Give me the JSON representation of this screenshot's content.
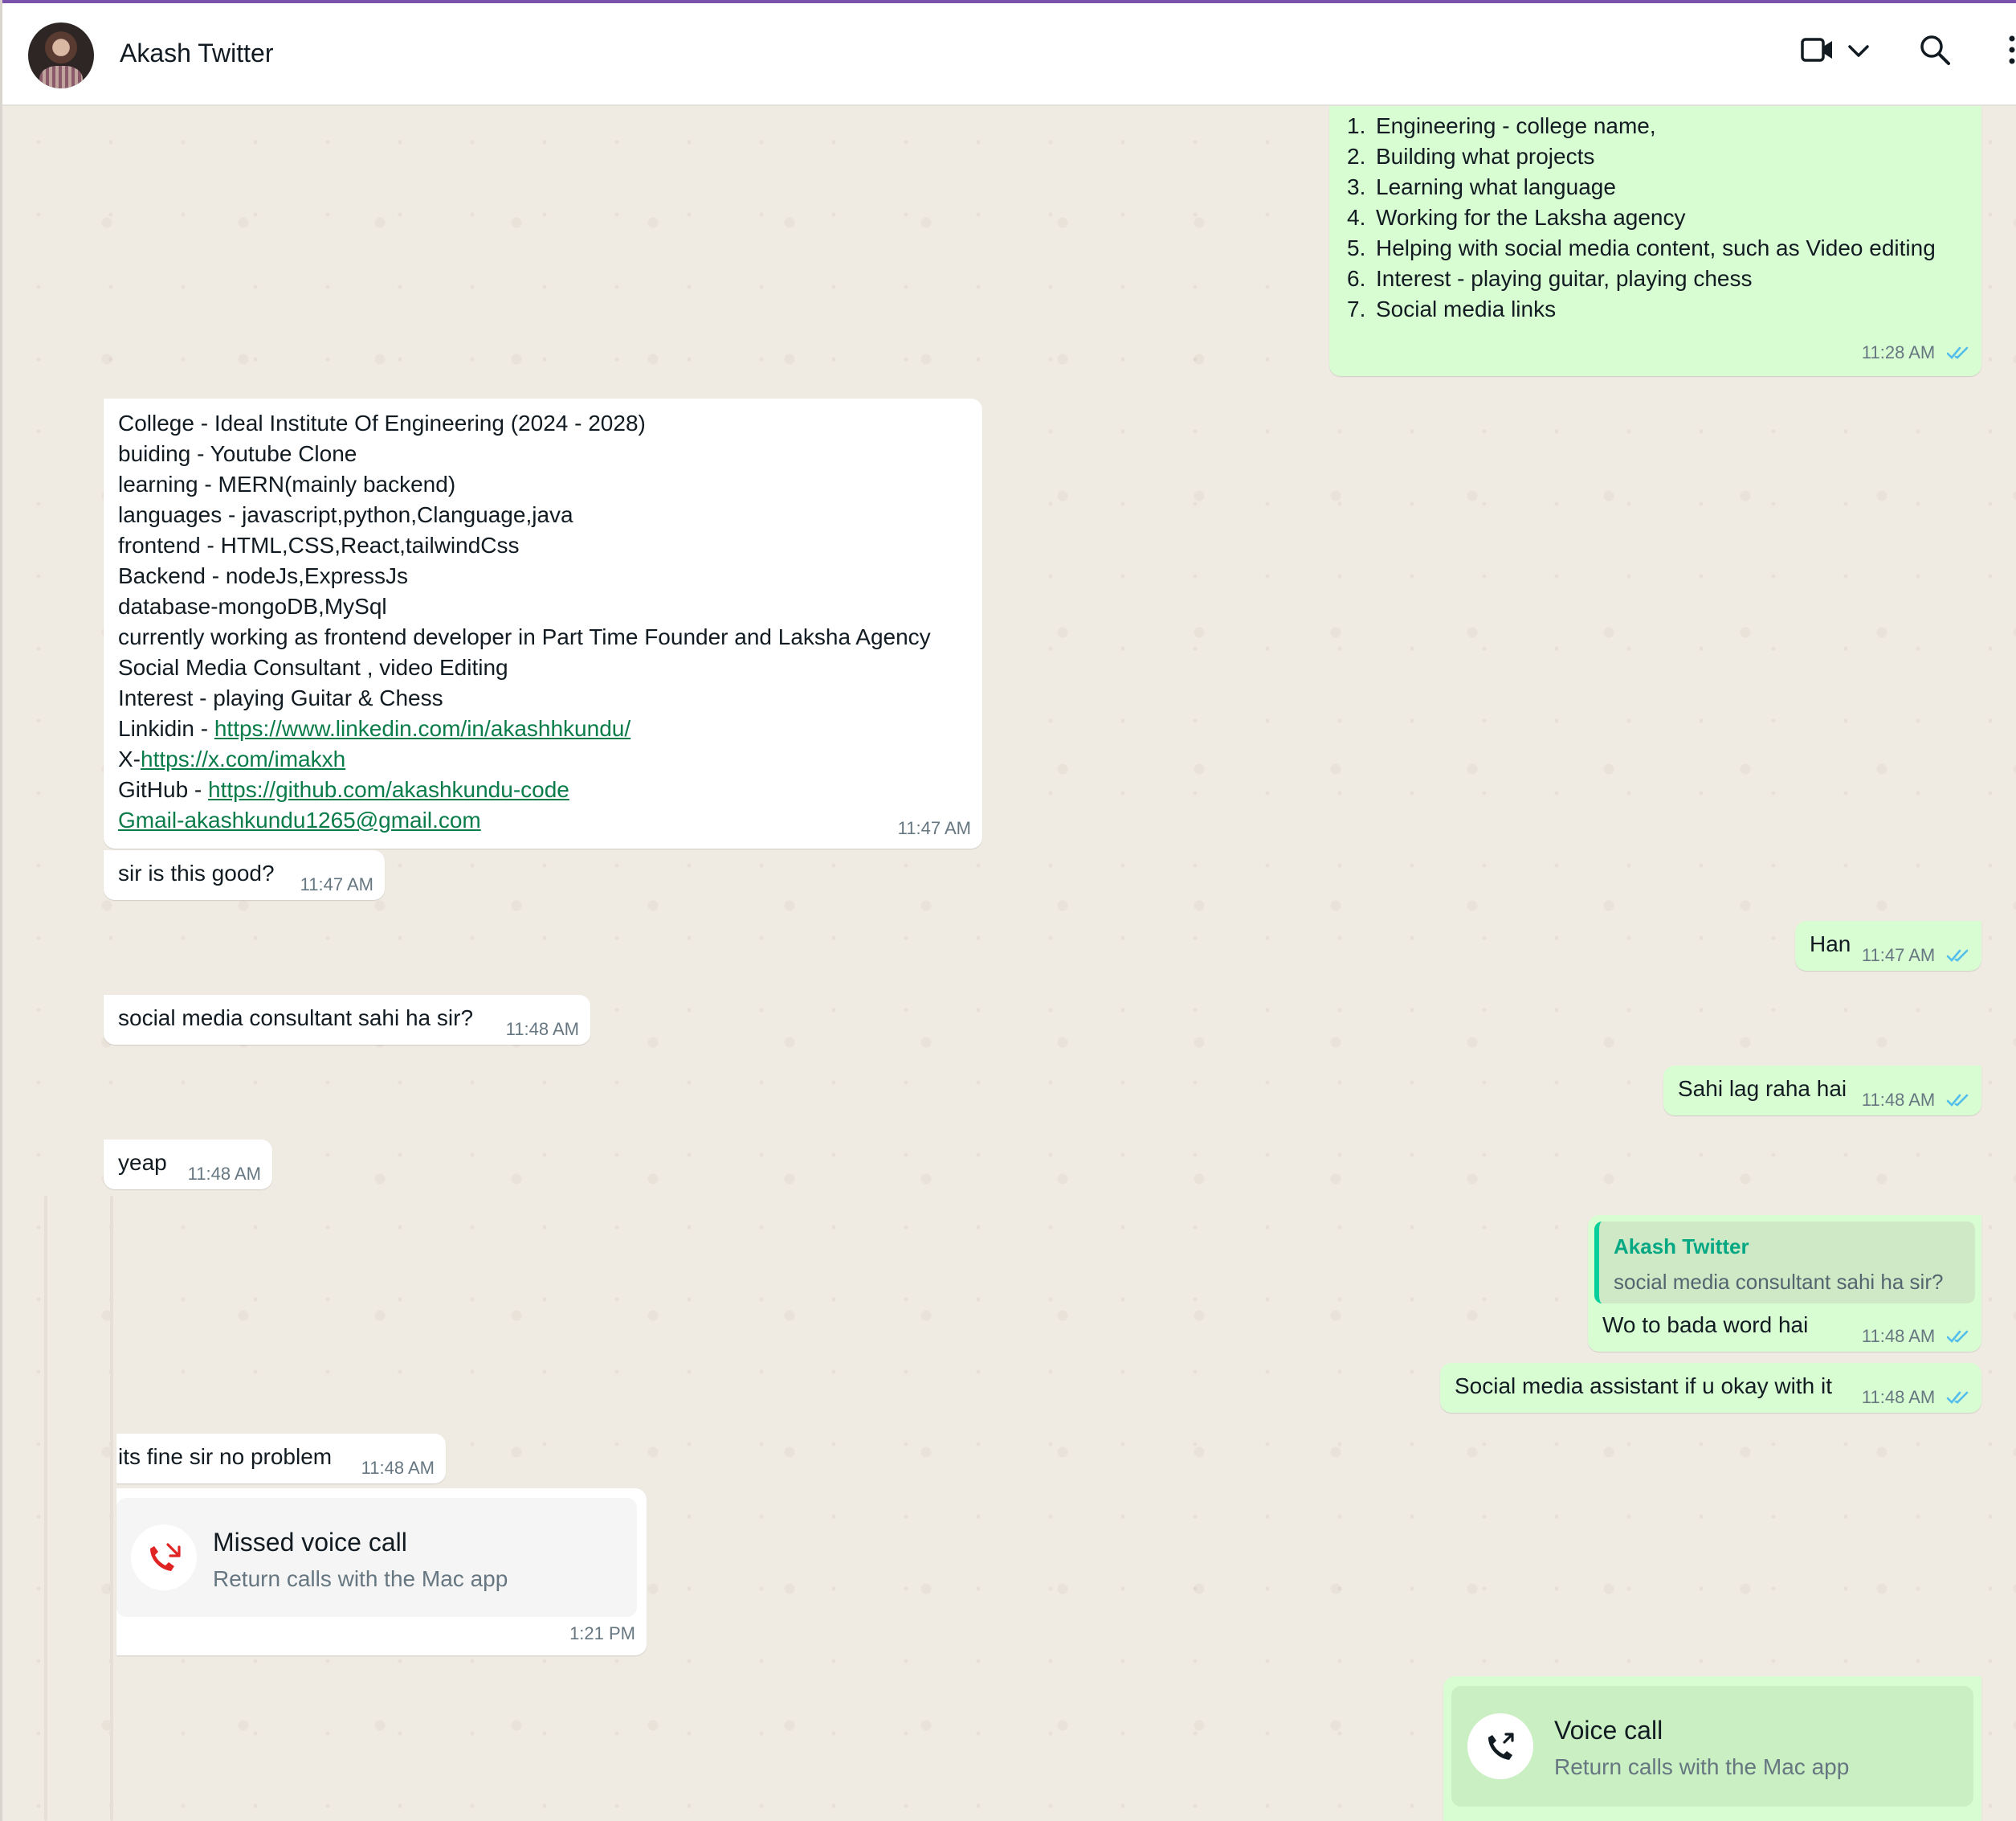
{
  "header": {
    "contact_name": "Akash Twitter",
    "icons": [
      "video-call-icon",
      "chevron-down-icon",
      "search-icon",
      "menu-icon"
    ]
  },
  "colors": {
    "incoming_bubble": "#ffffff",
    "outgoing_bubble": "#d9fdd3",
    "read_ticks": "#53bdeb",
    "quote_accent": "#06cf9c",
    "missed_call": "#e02424"
  },
  "messages": {
    "m1": {
      "items": [
        "Engineering - college name,",
        "Building what projects",
        "Learning what language",
        "Working for the Laksha agency",
        "Helping with social media content, such as Video editing",
        "Interest - playing guitar, playing chess",
        "Social media links"
      ],
      "numbers": [
        "1.",
        "2.",
        "3.",
        "4.",
        "5.",
        "6.",
        "7."
      ],
      "time": "11:28 AM"
    },
    "m2": {
      "lines": [
        "College - Ideal Institute Of Engineering (2024 - 2028)",
        "buiding - Youtube Clone",
        "learning - MERN(mainly backend)",
        "languages - javascript,python,Clanguage,java",
        "frontend - HTML,CSS,React,tailwindCss",
        "Backend - nodeJs,ExpressJs",
        "database-mongoDB,MySql",
        "currently working as frontend developer in Part Time Founder and Laksha Agency",
        "Social Media Consultant , video Editing",
        "Interest - playing Guitar & Chess"
      ],
      "linkedin_label": "Linkidin - ",
      "linkedin_url": "https://www.linkedin.com/in/akashhkundu/",
      "x_label": "X-",
      "x_url": "https://x.com/imakxh",
      "github_label": "GitHub - ",
      "github_url": "https://github.com/akashkundu-code",
      "gmail": "Gmail-akashkundu1265@gmail.com",
      "time": "11:47 AM"
    },
    "m3": {
      "text": "sir is this good?",
      "time": "11:47 AM"
    },
    "m4": {
      "text": "Han",
      "time": "11:47 AM"
    },
    "m5": {
      "text": "social media consultant sahi ha sir?",
      "time": "11:48 AM"
    },
    "m6": {
      "text": "Sahi lag raha hai",
      "time": "11:48 AM"
    },
    "m7": {
      "text": "yeap",
      "time": "11:48 AM"
    },
    "m8": {
      "quote_author": "Akash Twitter",
      "quote_text": "social media consultant sahi ha sir?",
      "text": "Wo to bada word hai",
      "time": "11:48 AM"
    },
    "m9": {
      "text": "Social media assistant if u okay with it",
      "time": "11:48 AM"
    },
    "m10": {
      "text": "its fine sir no problem",
      "time": "11:48 AM"
    },
    "m11": {
      "title": "Missed voice call",
      "subtitle": "Return calls with the Mac app",
      "time": "1:21 PM"
    },
    "m12": {
      "title": "Voice call",
      "subtitle": "Return calls with the Mac app"
    }
  }
}
